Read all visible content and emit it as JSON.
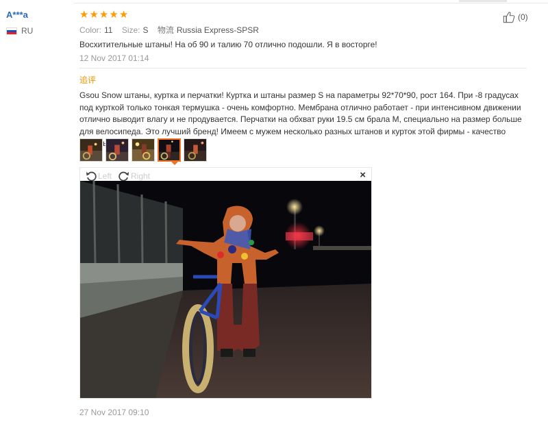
{
  "review": {
    "user": "A***a",
    "country": "RU",
    "rating": 5,
    "stars": [
      "★",
      "★",
      "★",
      "★",
      "★"
    ],
    "helpful_count": "(0)",
    "color_label": "Color:",
    "color_value": "11",
    "size_label": "Size:",
    "size_value": "S",
    "logistics_label": "物流",
    "logistics_value": "Russia Express-SPSR",
    "text": "Восхитительные штаны! На об 90 и талию 70 отлично подошли. Я в восторге!",
    "date": "12 Nov 2017 01:14"
  },
  "followup": {
    "label": "追评",
    "text": "Gsou Snow штаны, куртка и перчатки! Куртка и штаны размер S на параметры 92*70*90, рост 164. При -8 градусах под курткой только тонкая термушка - очень комфортно. Мембрана отлично работает - при интенсивном движении отлично выводит влагу и не продувается. Перчатки на обхват руки 19.5 см брала M, специально на размер больше для велосипеда. Это лучший бренд! Имеем с мужем несколько разных штанов и курток этой фирмы - качество идеальное!",
    "date": "27 Nov 2017 09:10"
  },
  "gallery": {
    "thumbnails": [
      "photo-1",
      "photo-2",
      "photo-3",
      "photo-4",
      "photo-5"
    ],
    "selected_index": 3
  },
  "viewer": {
    "rotate_left": "Left",
    "rotate_right": "Right",
    "close": "×"
  },
  "colors": {
    "accent_orange": "#f57224",
    "star": "#ff9a00",
    "username": "#2e6cb5"
  }
}
